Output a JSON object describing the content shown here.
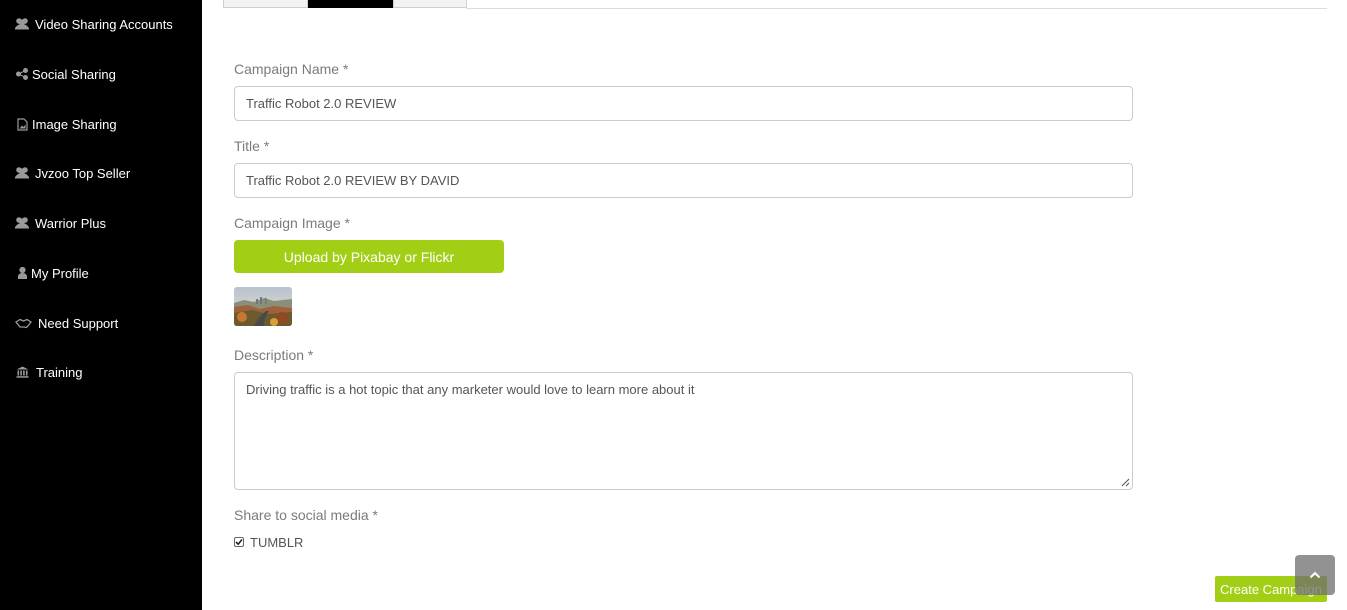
{
  "sidebar": {
    "items": [
      {
        "label": "Video Sharing Accounts",
        "icon": "users-icon"
      },
      {
        "label": "Social Sharing",
        "icon": "share-icon"
      },
      {
        "label": "Image Sharing",
        "icon": "image-file-icon"
      },
      {
        "label": "Jvzoo Top Seller",
        "icon": "users-icon"
      },
      {
        "label": "Warrior Plus",
        "icon": "users-icon"
      },
      {
        "label": "My Profile",
        "icon": "user-icon"
      },
      {
        "label": "Need Support",
        "icon": "handshake-icon"
      },
      {
        "label": "Training",
        "icon": "institution-icon"
      }
    ]
  },
  "form": {
    "campaign_name_label": "Campaign Name *",
    "campaign_name_value": "Traffic Robot 2.0 REVIEW",
    "title_label": "Title *",
    "title_value": "Traffic Robot 2.0 REVIEW BY DAVID",
    "campaign_image_label": "Campaign Image *",
    "upload_button_label": "Upload by Pixabay or Flickr",
    "description_label": "Description *",
    "description_value": "Driving traffic is a hot topic that any marketer would love to learn more about it",
    "share_label": "Share to social media *",
    "share_options": [
      {
        "label": "TUMBLR",
        "checked": true
      }
    ]
  },
  "actions": {
    "create_label": "Create Campaign"
  },
  "colors": {
    "sidebar_bg": "#000000",
    "accent_green": "#a2cf16",
    "label_text": "#7b7b7b"
  }
}
